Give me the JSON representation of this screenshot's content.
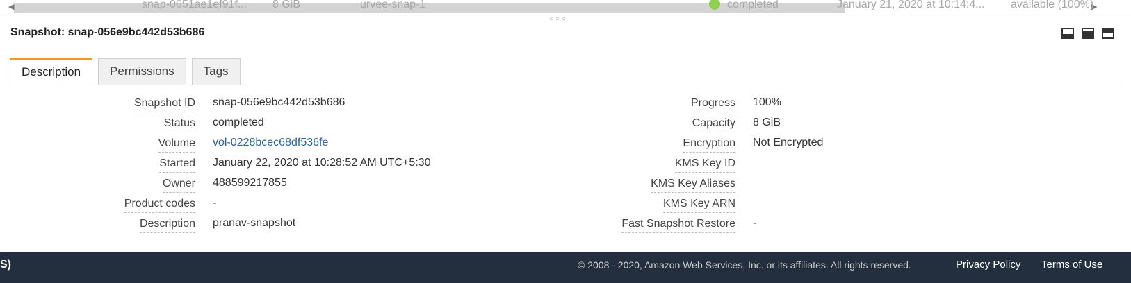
{
  "top_row": {
    "snapshot_id": "snap-0651ae1ef91f...",
    "size": "8 GiB",
    "description": "urvee-snap-1",
    "status": "completed",
    "started": "January 21, 2020 at 10:14:4...",
    "progress": "available (100%)"
  },
  "panel": {
    "title": "Snapshot: snap-056e9bc442d53b686"
  },
  "tabs": [
    {
      "label": "Description"
    },
    {
      "label": "Permissions"
    },
    {
      "label": "Tags"
    }
  ],
  "details_left": [
    {
      "label": "Snapshot ID",
      "value": "snap-056e9bc442d53b686"
    },
    {
      "label": "Status",
      "value": "completed"
    },
    {
      "label": "Volume",
      "value": "vol-0228bcec68df536fe"
    },
    {
      "label": "Started",
      "value": "January 22, 2020 at 10:28:52 AM UTC+5:30"
    },
    {
      "label": "Owner",
      "value": "488599217855"
    },
    {
      "label": "Product codes",
      "value": "-"
    },
    {
      "label": "Description",
      "value": "pranav-snapshot"
    }
  ],
  "details_right": [
    {
      "label": "Progress",
      "value": "100%"
    },
    {
      "label": "Capacity",
      "value": "8 GiB"
    },
    {
      "label": "Encryption",
      "value": "Not Encrypted"
    },
    {
      "label": "KMS Key ID",
      "value": ""
    },
    {
      "label": "KMS Key Aliases",
      "value": ""
    },
    {
      "label": "KMS Key ARN",
      "value": ""
    },
    {
      "label": "Fast Snapshot Restore",
      "value": "-"
    }
  ],
  "footer": {
    "left_fragment": "S)",
    "copyright": "© 2008 - 2020, Amazon Web Services, Inc. or its affiliates. All rights reserved.",
    "privacy_label": "Privacy Policy",
    "terms_label": "Terms of Use"
  },
  "colors": {
    "tab_accent": "#f29a26",
    "link": "#2a6496",
    "footer_bg": "#232f3e",
    "status_green": "#8fd14f"
  }
}
